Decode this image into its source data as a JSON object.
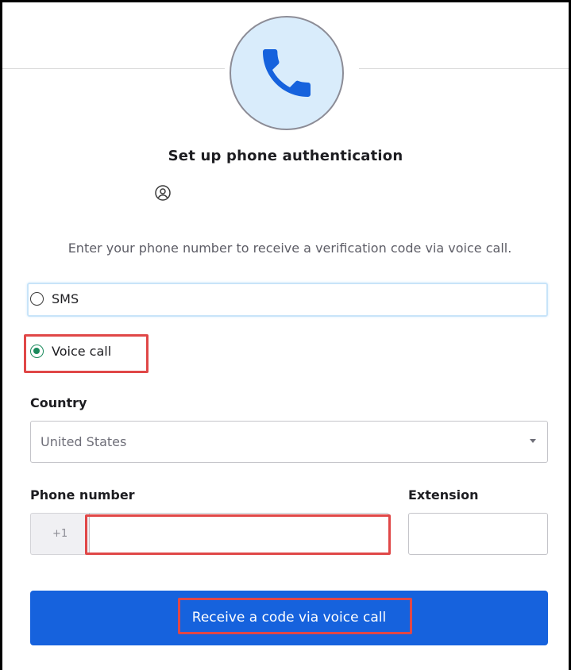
{
  "header": {
    "icon": "phone-icon",
    "title": "Set up phone authentication",
    "user_icon": "user-circle-icon"
  },
  "description": "Enter your phone number to receive a verification code via voice call.",
  "method": {
    "options": [
      {
        "label": "SMS",
        "selected": false
      },
      {
        "label": "Voice call",
        "selected": true
      }
    ]
  },
  "country": {
    "label": "Country",
    "value": "United States"
  },
  "phone": {
    "label": "Phone number",
    "prefix": "+1",
    "value": ""
  },
  "extension": {
    "label": "Extension",
    "value": ""
  },
  "submit": {
    "label": "Receive a code via voice call"
  },
  "colors": {
    "primary_button": "#1662dd",
    "icon_circle_bg": "#d9ecfb",
    "phone_icon": "#1662dd",
    "radio_selected": "#1a8a5c",
    "annotation_highlight": "#e04747"
  }
}
